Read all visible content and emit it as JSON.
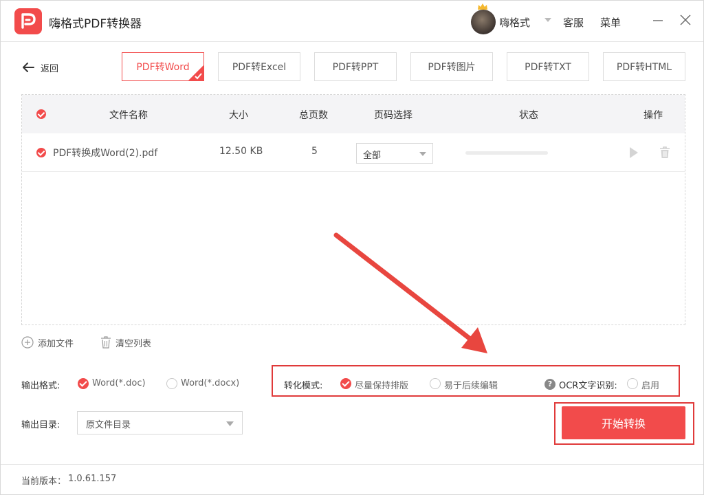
{
  "app": {
    "title": "嗨格式PDF转换器"
  },
  "header": {
    "username": "嗨格式",
    "service_label": "客服",
    "menu_label": "菜单"
  },
  "nav": {
    "back_label": "返回"
  },
  "tabs": [
    {
      "label": "PDF转Word",
      "active": true
    },
    {
      "label": "PDF转Excel",
      "active": false
    },
    {
      "label": "PDF转PPT",
      "active": false
    },
    {
      "label": "PDF转图片",
      "active": false
    },
    {
      "label": "PDF转TXT",
      "active": false
    },
    {
      "label": "PDF转HTML",
      "active": false
    }
  ],
  "table": {
    "columns": {
      "name": "文件名称",
      "size": "大小",
      "pages": "总页数",
      "page_select": "页码选择",
      "status": "状态",
      "actions": "操作"
    },
    "rows": [
      {
        "name": "PDF转换成Word(2).pdf",
        "size": "12.50 KB",
        "pages": "5",
        "page_select": "全部",
        "progress": 0
      }
    ]
  },
  "actions": {
    "add_file": "添加文件",
    "clear_list": "清空列表"
  },
  "output_format": {
    "label": "输出格式:",
    "options": [
      {
        "label": "Word(*.doc)",
        "selected": true
      },
      {
        "label": "Word(*.docx)",
        "selected": false
      }
    ]
  },
  "conversion_mode": {
    "label": "转化模式:",
    "options": [
      {
        "label": "尽量保持排版",
        "selected": true
      },
      {
        "label": "易于后续编辑",
        "selected": false
      }
    ]
  },
  "ocr": {
    "label": "OCR文字识别:",
    "option_label": "启用",
    "enabled": false
  },
  "output_dir": {
    "label": "输出目录:",
    "value": "原文件目录"
  },
  "start_button": {
    "label": "开始转换"
  },
  "footer": {
    "version_label": "当前版本：",
    "version": "1.0.61.157"
  },
  "colors": {
    "accent": "#f24b4b",
    "annotation": "#e03a3a"
  },
  "icons": {
    "logo": "pdf-logo-icon",
    "crown": "crown-icon",
    "back": "arrow-left-icon",
    "play": "play-icon",
    "delete": "trash-icon",
    "add": "plus-circle-icon",
    "clear": "trash-icon",
    "help": "help-icon",
    "minimize": "minimize-icon",
    "close": "close-icon",
    "caret": "chevron-down-icon"
  }
}
